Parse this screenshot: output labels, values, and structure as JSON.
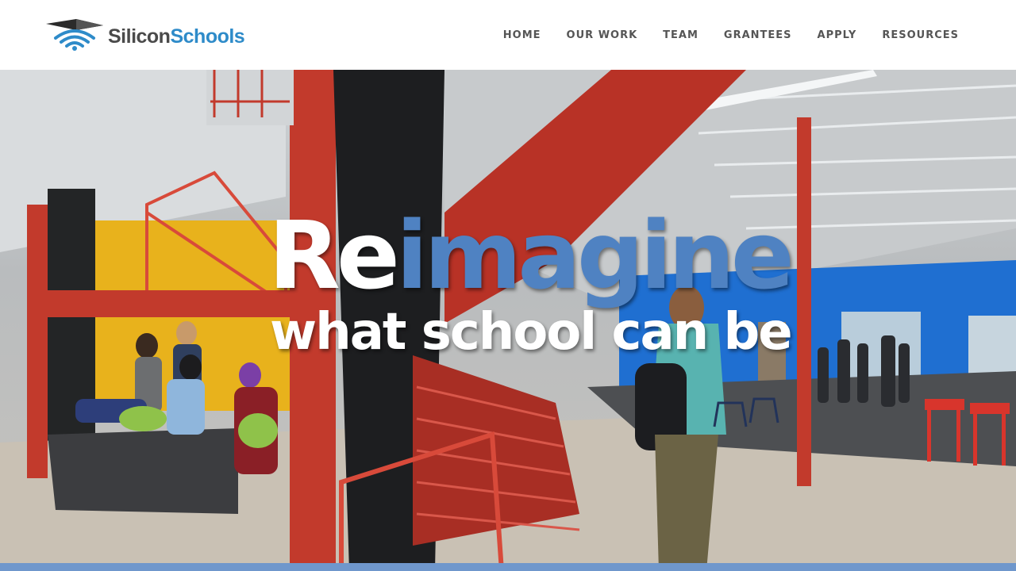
{
  "header": {
    "logo": {
      "part1": "Silicon",
      "part2": "Schools"
    },
    "nav": [
      {
        "label": "HOME"
      },
      {
        "label": "OUR WORK"
      },
      {
        "label": "TEAM"
      },
      {
        "label": "GRANTEES"
      },
      {
        "label": "APPLY"
      },
      {
        "label": "RESOURCES"
      }
    ]
  },
  "hero": {
    "headline_prefix": "Re",
    "headline_highlight": "imagine",
    "subheadline": "what school can be"
  },
  "colors": {
    "brand_blue": "#2e8bc9",
    "headline_blue": "#4f82c2",
    "nav_text": "#555555",
    "stair_red": "#c23a2c",
    "wall_blue": "#1f6fd1",
    "wall_yellow": "#e8b21c"
  },
  "icons": [
    "wifi-graduation-cap-icon"
  ]
}
